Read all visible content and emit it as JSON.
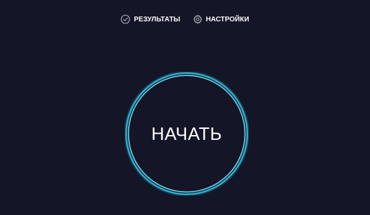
{
  "nav": {
    "items": [
      {
        "label": "РЕЗУЛЬТАТЫ",
        "icon": "check-circle-icon"
      },
      {
        "label": "НАСТРОЙКИ",
        "icon": "gear-icon"
      }
    ]
  },
  "start": {
    "label": "НАЧАТЬ"
  },
  "colors": {
    "background": "#141526",
    "ring_outer": "#2fb4d6",
    "ring_inner": "#6fd8ee",
    "text": "#ffffff",
    "icon": "#b8bcc8"
  }
}
